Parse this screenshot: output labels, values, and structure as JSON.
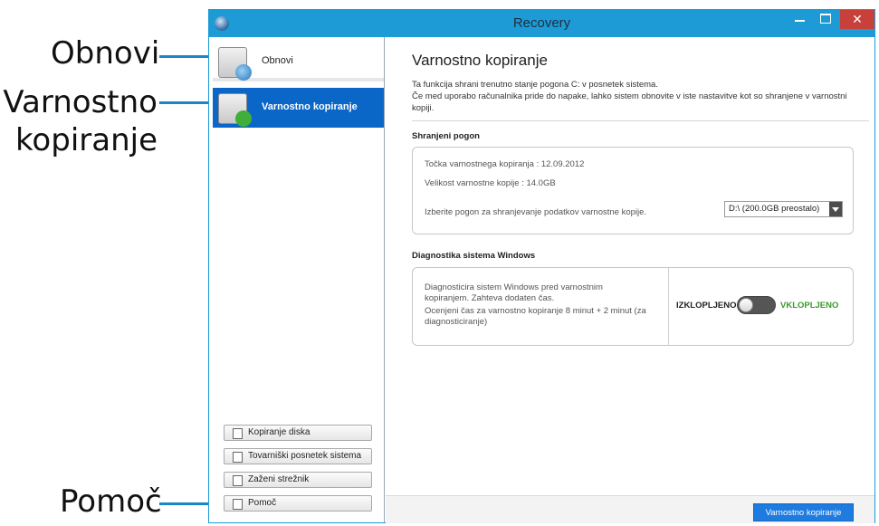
{
  "callouts": {
    "obnovi": "Obnovi",
    "varnostno_line1": "Varnostno",
    "varnostno_line2": "kopiranje",
    "pomoc": "Pomoč"
  },
  "window": {
    "title": "Recovery",
    "close_glyph": "✕"
  },
  "sidebar": {
    "nav": [
      {
        "label": "Obnovi",
        "icon": "restore-icon"
      },
      {
        "label": "Varnostno kopiranje",
        "icon": "backup-icon",
        "selected": true
      }
    ],
    "buttons": [
      {
        "label": "Kopiranje diska",
        "icon": "disk-copy-icon"
      },
      {
        "label": "Tovarniški posnetek sistema",
        "icon": "factory-image-icon"
      },
      {
        "label": "Zaženi strežnik",
        "icon": "server-icon"
      },
      {
        "label": "Pomoč",
        "icon": "help-icon"
      }
    ]
  },
  "main": {
    "title": "Varnostno kopiranje",
    "desc_line1": "Ta funkcija shrani trenutno stanje pogona C: v posnetek sistema.",
    "desc_line2": "Če med uporabo računalnika pride do napake, lahko sistem obnovite v iste nastavitve kot so shranjene v varnostni kopiji.",
    "saved_drive": {
      "heading": "Shranjeni pogon",
      "backup_point": "Točka varnostnega kopiranja : 12.09.2012",
      "backup_size": "Velikost varnostne kopije : 14.0GB",
      "choose_drive": "Izberite pogon za shranjevanje podatkov varnostne kopije.",
      "drive_value": "D:\\ (200.0GB preostalo)"
    },
    "diagnostics": {
      "heading": "Diagnostika sistema Windows",
      "text1": "Diagnosticira sistem Windows pred varnostnim kopiranjem. Zahteva dodaten čas.",
      "text2": "Ocenjeni čas za varnostno kopiranje 8 minut + 2 minut (za diagnosticiranje)",
      "off_label": "IZKLOPLJENO",
      "on_label": "VKLOPLJENO",
      "enabled": false
    },
    "action_button": "Varnostno kopiranje"
  },
  "colors": {
    "titlebar": "#1c9bd6",
    "selected_nav": "#0b67c7",
    "callout_line": "#1a86c8",
    "on_label": "#3a9a2a",
    "primary_button": "#1e7ce0"
  }
}
